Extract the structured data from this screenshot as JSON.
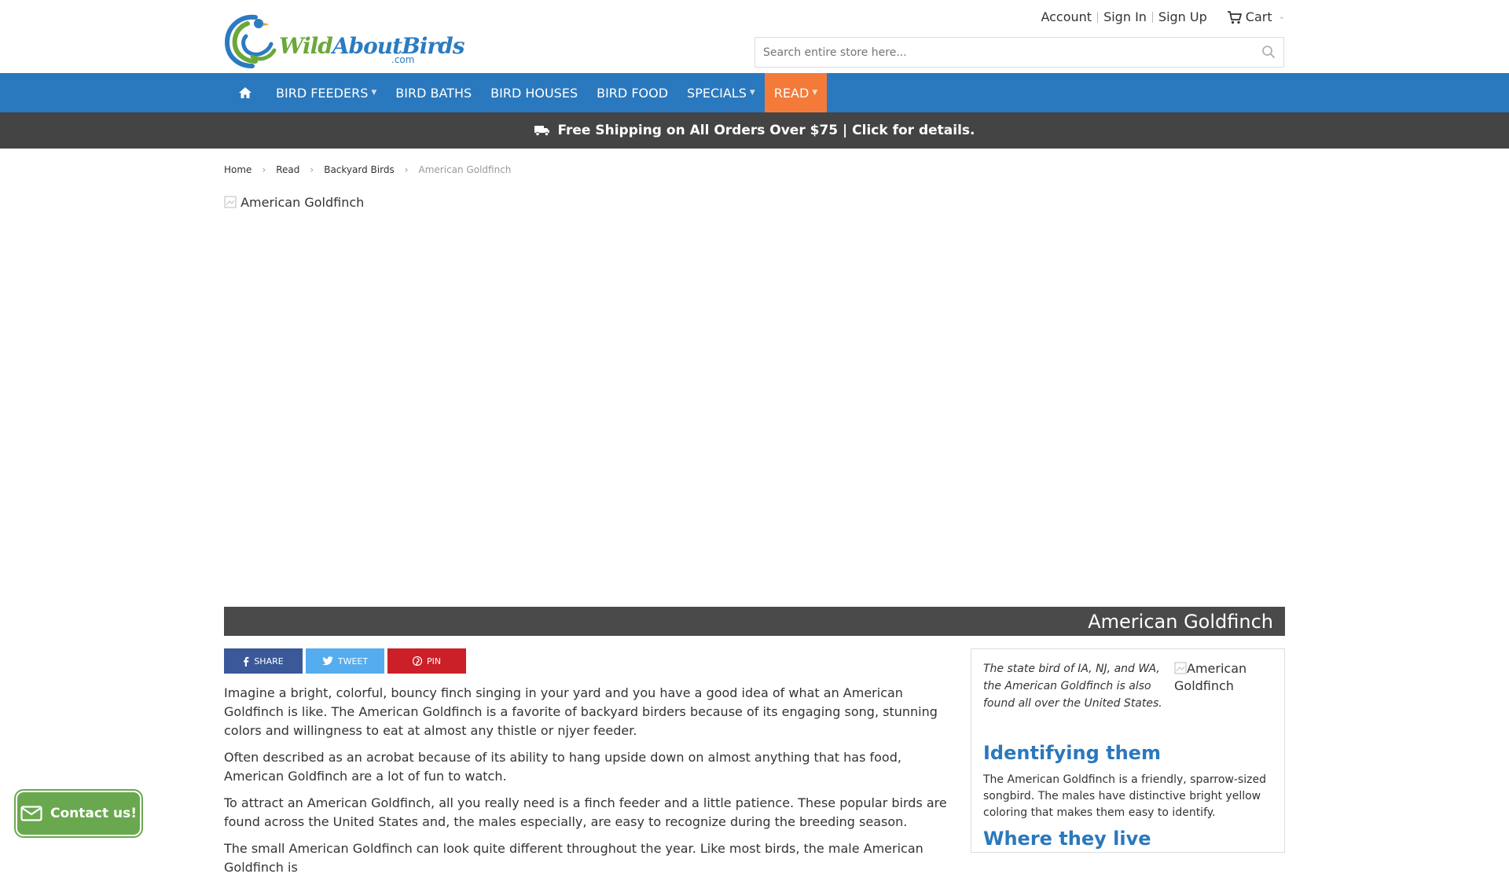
{
  "logo": {
    "brand_main": "Wild",
    "brand_rest": "AboutBirds",
    "brand_suffix": ".com"
  },
  "toplinks": {
    "account": "Account",
    "sign_in": "Sign In",
    "sign_up": "Sign Up",
    "cart": "Cart"
  },
  "search": {
    "placeholder": "Search entire store here..."
  },
  "nav": {
    "items": [
      {
        "label": "BIRD FEEDERS"
      },
      {
        "label": "BIRD BATHS"
      },
      {
        "label": "BIRD HOUSES"
      },
      {
        "label": "BIRD FOOD"
      },
      {
        "label": "SPECIALS"
      },
      {
        "label": "READ"
      }
    ],
    "active_color": "#f47a3a",
    "bar_color": "#2a78bd"
  },
  "shipping": {
    "text": "Free Shipping on All Orders Over $75 | Click for details."
  },
  "breadcrumb": {
    "home": "Home",
    "read": "Read",
    "category": "Backyard Birds",
    "current": "American Goldfinch"
  },
  "hero": {
    "alt": "American Goldfinch"
  },
  "title": "American Goldfinch",
  "share": {
    "facebook": "SHARE",
    "twitter": "TWEET",
    "pinterest": "PIN"
  },
  "content": {
    "paragraphs": [
      "Imagine a bright, colorful, bouncy finch singing in your yard and you have a good idea of what an American Goldfinch is like. The American Goldfinch is a favorite of backyard birders because of its engaging song, stunning colors and willingness to eat at almost any thistle or njyer feeder.",
      "Often described as an acrobat because of its ability to hang upside down on almost anything that has food, American Goldfinch are a lot of fun to watch.",
      "To attract an American Goldfinch, all you really need is a finch feeder and a little patience. These popular birds are found across the United States and, the males especially, are easy to recognize during the breeding season.",
      "The small American Goldfinch can look quite different throughout the year. Like most birds, the male American Goldfinch is"
    ]
  },
  "sidebar": {
    "caption": "The state bird of IA, NJ, and WA, the American Goldfinch is also found all over the United States.",
    "image_alt": "American Goldfinch",
    "heading1": "Identifying them",
    "text1": "The American Goldfinch is a friendly, sparrow-sized songbird. The males have distinctive bright yellow coloring that makes them easy to identify.",
    "heading2": "Where they live"
  },
  "contact": {
    "label": "Contact us!"
  }
}
